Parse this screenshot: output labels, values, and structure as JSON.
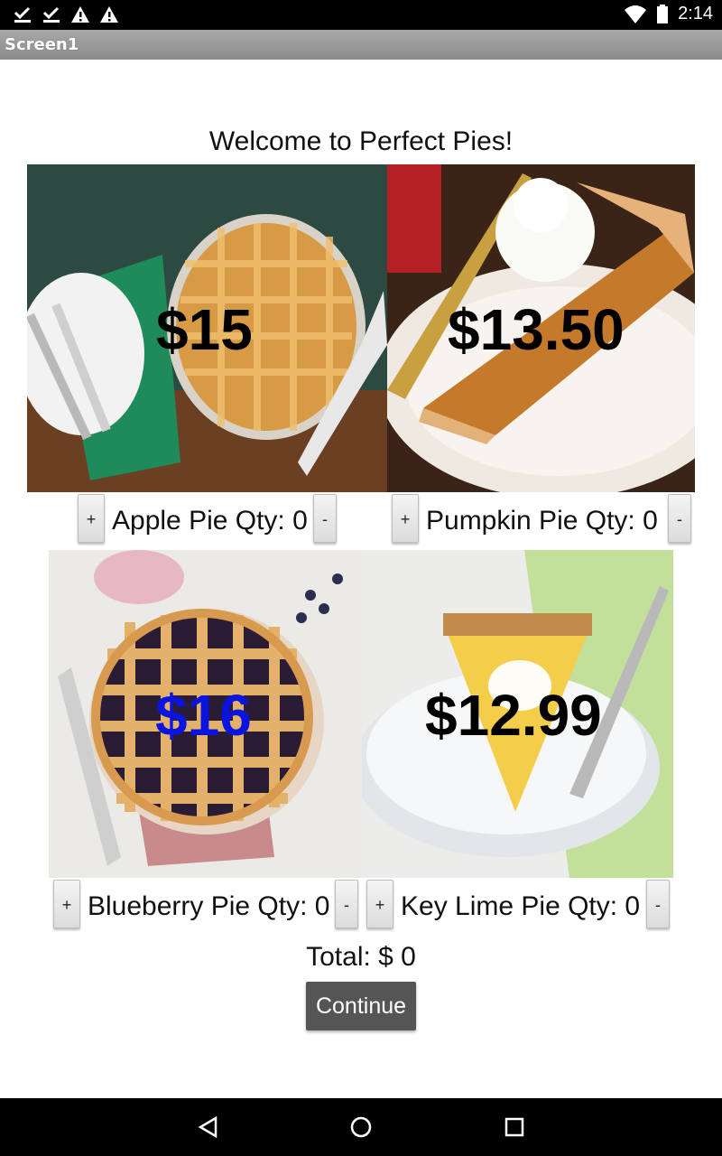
{
  "status_bar": {
    "time": "2:14",
    "icons": [
      "download-done-icon",
      "download-done-icon",
      "warning-icon",
      "warning-icon",
      "wifi-icon",
      "battery-icon"
    ]
  },
  "title_bar": {
    "title": "Screen1"
  },
  "welcome": "Welcome to Perfect Pies!",
  "pies": [
    {
      "name": "apple",
      "price": "$15",
      "qty_label": "Apple Pie Qty: 0",
      "plus": "+",
      "minus": "-"
    },
    {
      "name": "pumpkin",
      "price": "$13.50",
      "qty_label": "Pumpkin Pie Qty: 0",
      "plus": "+",
      "minus": "-"
    },
    {
      "name": "blueberry",
      "price": "$16",
      "qty_label": "Blueberry Pie Qty: 0",
      "plus": "+",
      "minus": "-",
      "price_color": "#0a14e0"
    },
    {
      "name": "key-lime",
      "price": "$12.99",
      "qty_label": "Key Lime Pie Qty: 0",
      "plus": "+",
      "minus": "-"
    }
  ],
  "total": "Total: $ 0",
  "continue_label": "Continue",
  "nav_bar": {
    "icons": [
      "back-icon",
      "home-icon",
      "recents-icon"
    ]
  }
}
